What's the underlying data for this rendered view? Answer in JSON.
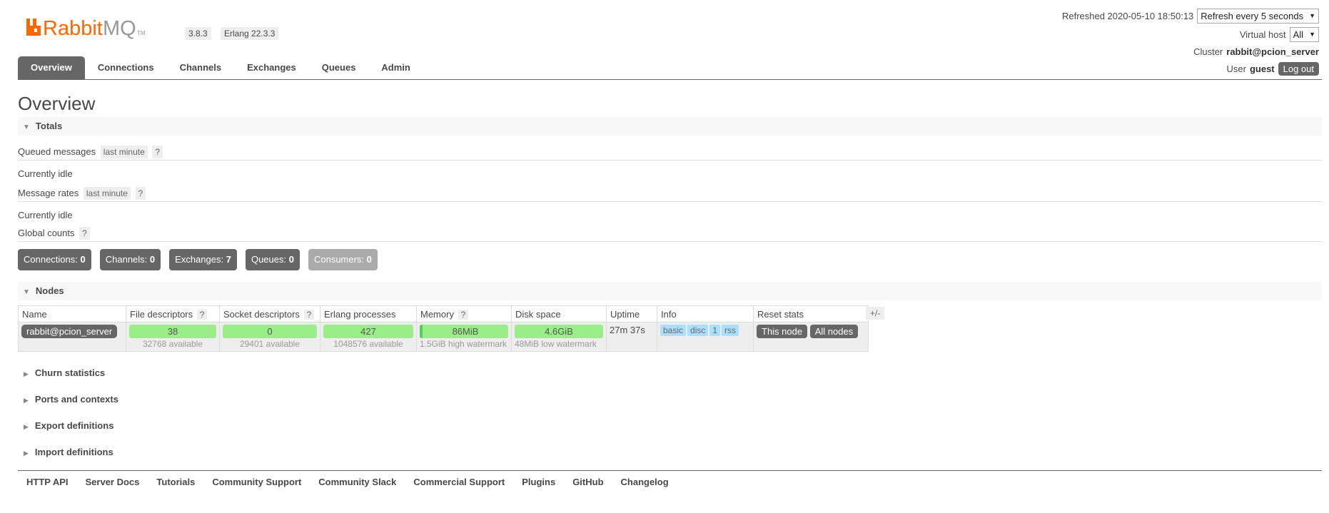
{
  "header": {
    "logo_text": "RabbitMQ",
    "logo_tm": "TM",
    "version": "3.8.3",
    "erlang": "Erlang 22.3.3",
    "refreshed": "Refreshed 2020-05-10 18:50:13",
    "refresh_select": "Refresh every 5 seconds",
    "vhost_label": "Virtual host",
    "vhost_value": "All",
    "cluster_label": "Cluster",
    "cluster_value": "rabbit@pcion_server",
    "user_label": "User",
    "user_value": "guest",
    "logout": "Log out"
  },
  "tabs": [
    "Overview",
    "Connections",
    "Channels",
    "Exchanges",
    "Queues",
    "Admin"
  ],
  "page_title": "Overview",
  "totals": {
    "heading": "Totals",
    "queued_label": "Queued messages",
    "queued_range": "last minute",
    "help": "?",
    "idle1": "Currently idle",
    "rates_label": "Message rates",
    "rates_range": "last minute",
    "idle2": "Currently idle",
    "global_label": "Global counts"
  },
  "counts": [
    {
      "label": "Connections:",
      "value": "0"
    },
    {
      "label": "Channels:",
      "value": "0"
    },
    {
      "label": "Exchanges:",
      "value": "7"
    },
    {
      "label": "Queues:",
      "value": "0"
    },
    {
      "label": "Consumers:",
      "value": "0"
    }
  ],
  "nodes": {
    "heading": "Nodes",
    "plus_minus": "+/-",
    "columns": [
      "Name",
      "File descriptors",
      "Socket descriptors",
      "Erlang processes",
      "Memory",
      "Disk space",
      "Uptime",
      "Info",
      "Reset stats"
    ],
    "row": {
      "name": "rabbit@pcion_server",
      "fd": "38",
      "fd_avail": "32768 available",
      "sd": "0",
      "sd_avail": "29401 available",
      "proc": "427",
      "proc_avail": "1048576 available",
      "mem": "86MiB",
      "mem_sub": "1.5GiB high watermark",
      "disk": "4.6GiB",
      "disk_sub": "48MiB low watermark",
      "uptime": "27m 37s",
      "info": [
        "basic",
        "disc",
        "1",
        "rss"
      ],
      "this_node": "This node",
      "all_nodes": "All nodes"
    }
  },
  "collapsed_sections": [
    "Churn statistics",
    "Ports and contexts",
    "Export definitions",
    "Import definitions"
  ],
  "footer": [
    "HTTP API",
    "Server Docs",
    "Tutorials",
    "Community Support",
    "Community Slack",
    "Commercial Support",
    "Plugins",
    "GitHub",
    "Changelog"
  ],
  "colors": {
    "brand": "#f60",
    "bar_green": "#99ee88",
    "tag_blue": "#aae0ff",
    "dark": "#666666"
  }
}
